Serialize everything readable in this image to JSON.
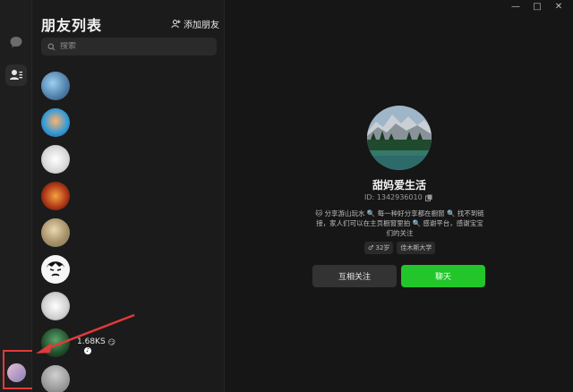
{
  "sidebar": {
    "icons": [
      "chat-bubble-icon",
      "friends-icon"
    ]
  },
  "friend_list": {
    "title": "朋友列表",
    "add_friend_label": "添加朋友",
    "search_placeholder": "搜索",
    "last_friend_name": "1.68KS",
    "last_friend_emoji": "😏"
  },
  "window_controls": {
    "minimize": "—",
    "maximize": "□",
    "close": "✕"
  },
  "profile": {
    "name": "甜妈爱生活",
    "id_text": "ID: 1342936010",
    "bio": "🐱 分享游山玩水 🔍 每一种好分享都在橱窗 🔍 找不到链接，家人们可以在主页橱窗里拍 🔍 感谢平台，感谢宝宝们的关注",
    "tags": [
      "♂ 32岁",
      "佳木斯大学"
    ]
  },
  "actions": {
    "mutual_label": "互相关注",
    "chat_label": "聊天"
  },
  "colors": {
    "background": "#161616",
    "panel": "#1b1b1b",
    "chat_button": "#22c62a",
    "annotation": "#e23a3a"
  }
}
